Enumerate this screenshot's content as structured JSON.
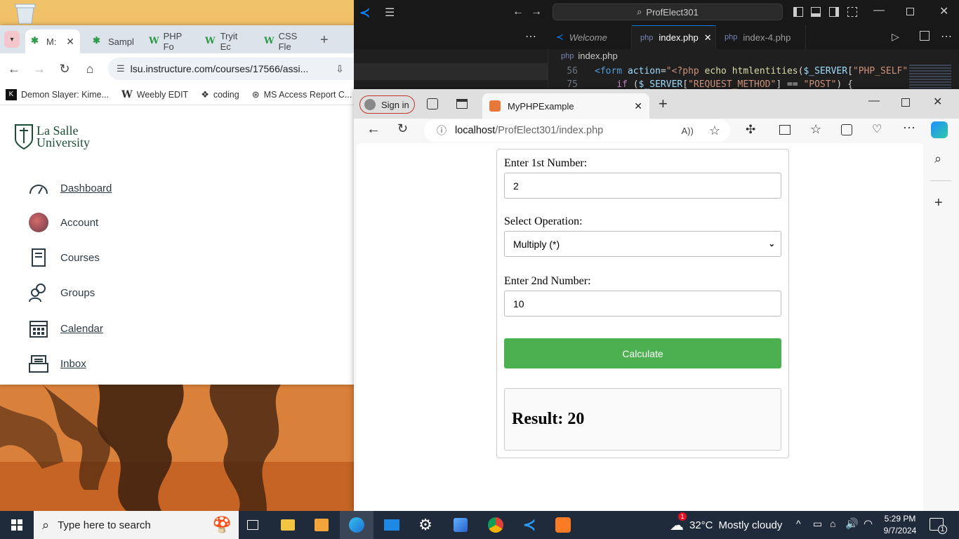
{
  "chrome": {
    "tabs": [
      {
        "label": "M:",
        "active": true
      },
      {
        "label": "Sampl",
        "active": false
      },
      {
        "label": "PHP Fo",
        "active": false
      },
      {
        "label": "Tryit Ec",
        "active": false
      },
      {
        "label": "CSS Fle",
        "active": false
      }
    ],
    "url": "lsu.instructure.com/courses/17566/assi...",
    "bookmarks": [
      "Demon Slayer: Kime...",
      "Weebly EDIT",
      "coding",
      "MS Access Report C..."
    ],
    "logo_line1": "La Salle",
    "logo_line2": "University",
    "nav": [
      {
        "label": "Dashboard",
        "icon": "speedometer-icon"
      },
      {
        "label": "Account",
        "icon": "avatar"
      },
      {
        "label": "Courses",
        "icon": "book-icon"
      },
      {
        "label": "Groups",
        "icon": "people-icon"
      },
      {
        "label": "Calendar",
        "icon": "calendar-icon"
      },
      {
        "label": "Inbox",
        "icon": "inbox-icon"
      }
    ]
  },
  "vscode": {
    "search": "ProfElect301",
    "tabs": [
      {
        "label": "Welcome"
      },
      {
        "label": "index.php"
      },
      {
        "label": "index-4.php"
      }
    ],
    "breadcrumb": "index.php",
    "lines": [
      {
        "num": "56",
        "text": "<form action=\"<?php echo htmlentities($_SERVER[\"PHP_SELF\""
      },
      {
        "num": "75",
        "text": "    if ($_SERVER[\"REQUEST_METHOD\"] == \"POST\") {"
      }
    ]
  },
  "edge": {
    "signin": "Sign in",
    "tab_title": "MyPHPExample",
    "url_host": "localhost",
    "url_path": "/ProfElect301/index.php"
  },
  "form": {
    "label1": "Enter 1st Number:",
    "value1": "2",
    "label_op": "Select Operation:",
    "operation": "Multiply (*)",
    "label2": "Enter 2nd Number:",
    "value2": "10",
    "button": "Calculate",
    "result": "Result: 20"
  },
  "taskbar": {
    "search_placeholder": "Type here to search",
    "weather_temp": "32°C",
    "weather_desc": "Mostly cloudy",
    "weather_badge": "1",
    "time": "5:29 PM",
    "date": "9/7/2024",
    "notif_count": "1"
  }
}
